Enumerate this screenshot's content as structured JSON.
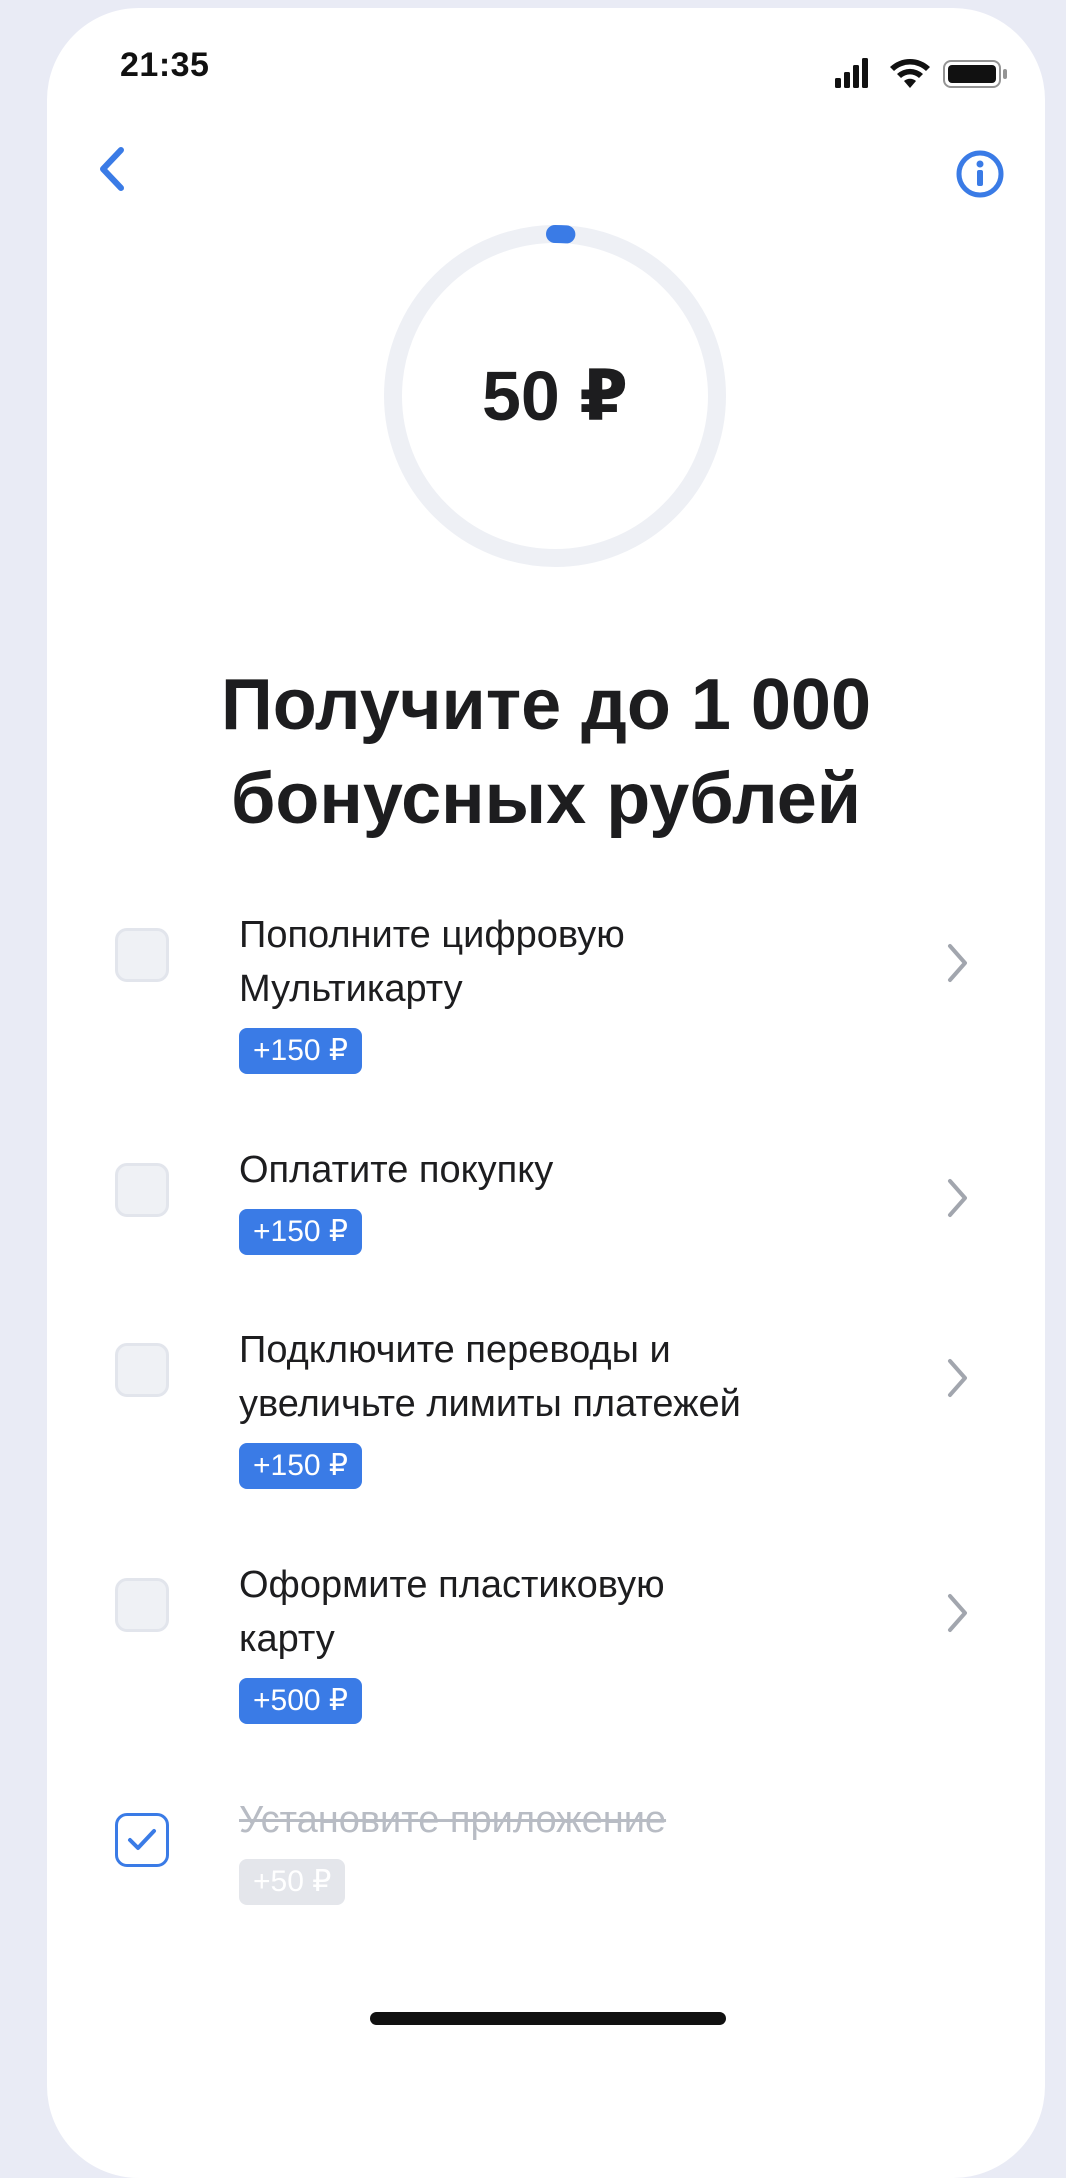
{
  "status_bar": {
    "time": "21:35"
  },
  "icons": {
    "back": "chevron-left-icon",
    "info": "info-icon",
    "signal": "cellular-signal-icon",
    "wifi": "wifi-icon",
    "battery": "battery-icon",
    "chevron": "chevron-right-icon",
    "check": "checkmark-icon"
  },
  "colors": {
    "accent": "#3a7be6",
    "text": "#1d1d1f",
    "muted": "#b8bcc4",
    "ring_track": "#eef0f5"
  },
  "progress": {
    "amount": "50 ₽",
    "earned": 50,
    "max": 1000
  },
  "headline": {
    "line1": "Получите до 1 000",
    "line2": "бонусных рублей"
  },
  "tasks": [
    {
      "title_line1": "Пополните цифровую",
      "title_line2": "Мультикарту",
      "bonus": "+150 ₽",
      "done": false
    },
    {
      "title_line1": "Оплатите покупку",
      "title_line2": "",
      "bonus": "+150 ₽",
      "done": false
    },
    {
      "title_line1": "Подключите переводы и",
      "title_line2": "увеличьте лимиты платежей",
      "bonus": "+150 ₽",
      "done": false
    },
    {
      "title_line1": "Оформите пластиковую",
      "title_line2": "карту",
      "bonus": "+500 ₽",
      "done": false
    },
    {
      "title_line1": "Установите приложение",
      "title_line2": "",
      "bonus": "+50 ₽",
      "done": true
    }
  ]
}
